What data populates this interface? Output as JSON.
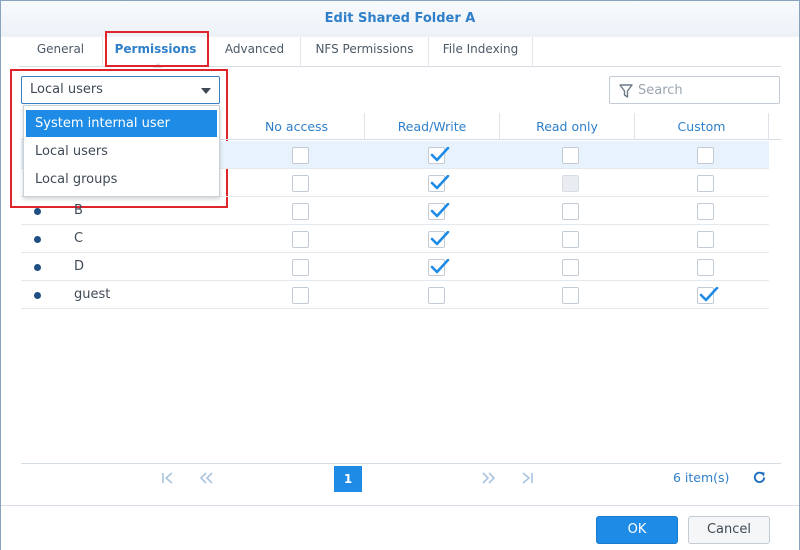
{
  "window": {
    "title": "Edit Shared Folder A"
  },
  "tabs": [
    {
      "label": "General"
    },
    {
      "label": "Permissions"
    },
    {
      "label": "Advanced"
    },
    {
      "label": "NFS Permissions"
    },
    {
      "label": "File Indexing"
    }
  ],
  "active_tab": "Permissions",
  "user_type_select": {
    "value": "Local users",
    "options": [
      {
        "label": "System internal user",
        "selected": true
      },
      {
        "label": "Local users",
        "selected": false
      },
      {
        "label": "Local groups",
        "selected": false
      }
    ]
  },
  "search": {
    "placeholder": "Search",
    "value": ""
  },
  "grid": {
    "columns": [
      "No access",
      "Read/Write",
      "Read only",
      "Custom"
    ],
    "rows": [
      {
        "name": "",
        "highlighted": true,
        "no_access": false,
        "read_write": true,
        "read_only": false,
        "read_only_disabled": false,
        "custom": false
      },
      {
        "name": "",
        "highlighted": false,
        "no_access": false,
        "read_write": true,
        "read_only": false,
        "read_only_disabled": true,
        "custom": false
      },
      {
        "name": "B",
        "highlighted": false,
        "no_access": false,
        "read_write": true,
        "read_only": false,
        "read_only_disabled": false,
        "custom": false
      },
      {
        "name": "C",
        "highlighted": false,
        "no_access": false,
        "read_write": true,
        "read_only": false,
        "read_only_disabled": false,
        "custom": false
      },
      {
        "name": "D",
        "highlighted": false,
        "no_access": false,
        "read_write": true,
        "read_only": false,
        "read_only_disabled": false,
        "custom": false
      },
      {
        "name": "guest",
        "highlighted": false,
        "no_access": false,
        "read_write": false,
        "read_only": false,
        "read_only_disabled": false,
        "custom": true
      }
    ]
  },
  "pagination": {
    "first_icon": "first-page-icon",
    "prev_icon": "prev-page-icon",
    "current_page": "1",
    "next_icon": "next-page-icon",
    "last_icon": "last-page-icon",
    "item_count": "6 item(s)",
    "refresh_icon": "refresh-icon"
  },
  "footer": {
    "ok_label": "OK",
    "cancel_label": "Cancel"
  },
  "colors": {
    "accent": "#1e8ce6",
    "title": "#2f7fc9",
    "highlight_box": "#e0242b",
    "row_highlight": "#e8f2fc"
  }
}
